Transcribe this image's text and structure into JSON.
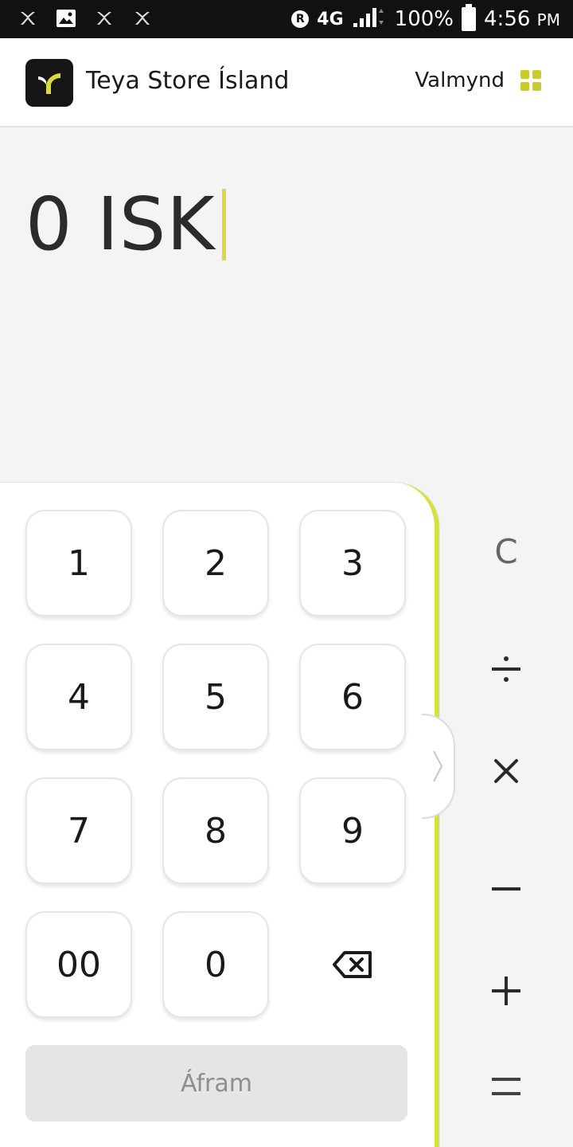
{
  "status_bar": {
    "network": "4G",
    "battery": "100%",
    "time": "4:56",
    "time_suffix": "PM"
  },
  "header": {
    "store_name": "Teya Store Ísland",
    "menu_label": "Valmynd"
  },
  "amount": {
    "display": "0 ISK"
  },
  "keypad": {
    "keys": [
      "1",
      "2",
      "3",
      "4",
      "5",
      "6",
      "7",
      "8",
      "9",
      "00",
      "0"
    ],
    "continue_label": "Áfram"
  },
  "operators": {
    "clear": "C"
  },
  "colors": {
    "accent": "#d7dc3a",
    "grid_icon": "#c9cc2a",
    "logo_bg": "#161616"
  }
}
